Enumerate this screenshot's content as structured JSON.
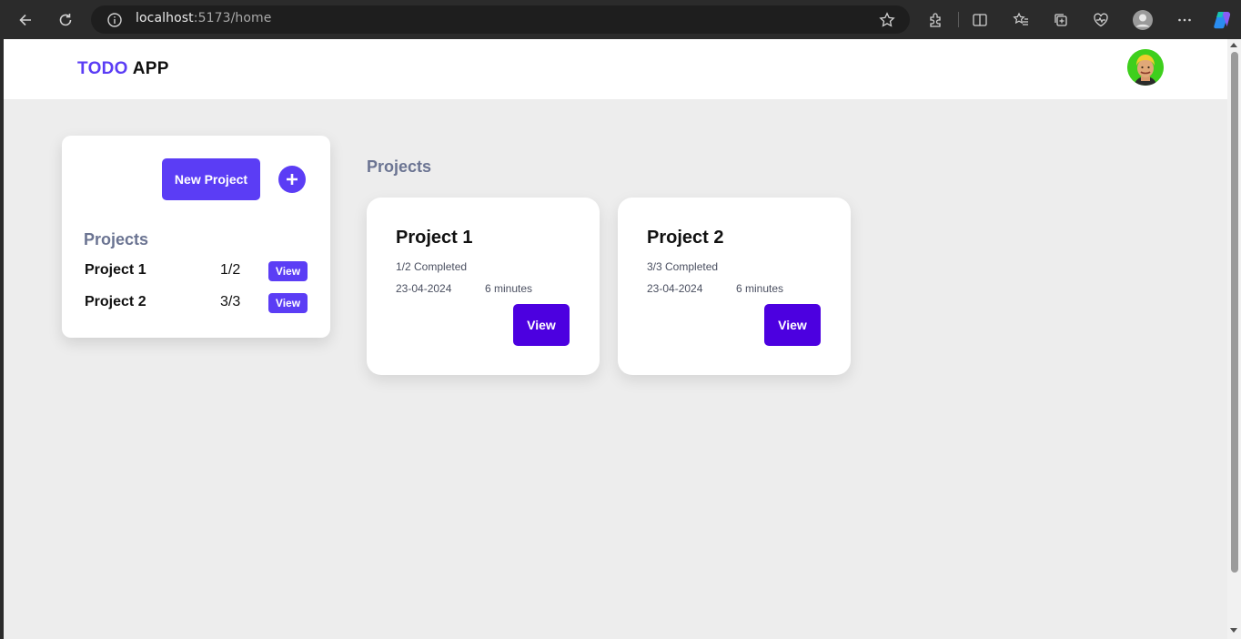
{
  "browser": {
    "url_host": "localhost",
    "url_rest": ":5173/home"
  },
  "app": {
    "logo_primary": "TODO",
    "logo_secondary": "APP",
    "colors": {
      "accent": "#5b3df5",
      "button_dark": "#4c00e0",
      "heading_muted": "#6b7492",
      "avatar_bg": "#3ecf1d"
    }
  },
  "sidebar": {
    "new_project_label": "New Project",
    "add_icon": "plus-circle-icon",
    "heading": "Projects",
    "items": [
      {
        "name": "Project 1",
        "count": "1/2",
        "view_label": "View"
      },
      {
        "name": "Project 2",
        "count": "3/3",
        "view_label": "View"
      }
    ]
  },
  "main": {
    "heading": "Projects",
    "cards": [
      {
        "title": "Project 1",
        "status": "1/2 Completed",
        "date": "23-04-2024",
        "time": "6 minutes",
        "view_label": "View"
      },
      {
        "title": "Project 2",
        "status": "3/3 Completed",
        "date": "23-04-2024",
        "time": "6 minutes",
        "view_label": "View"
      }
    ]
  }
}
